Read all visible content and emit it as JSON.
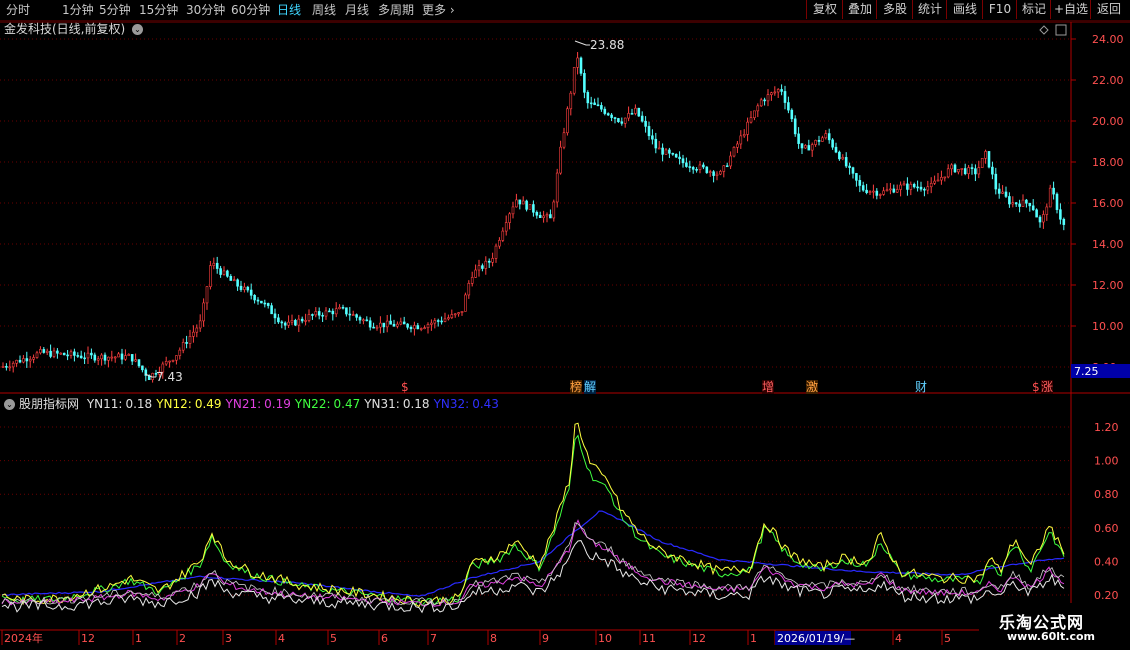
{
  "toolbar": {
    "periods": [
      "分时",
      "1分钟",
      "5分钟",
      "15分钟",
      "30分钟",
      "60分钟",
      "日线",
      "周线",
      "月线",
      "多周期",
      "更多"
    ],
    "active_period": "日线",
    "more_chevron": "chevron-right-icon",
    "buttons": [
      "复权",
      "叠加",
      "多股",
      "统计",
      "画线",
      "F10",
      "标记",
      "+自选",
      "返回"
    ]
  },
  "main_chart": {
    "stock_title": "金发科技(日线,前复权)",
    "high_label": "23.88",
    "low_label": "7.43",
    "current_price_tag": "7.25",
    "price_axis_ticks": [
      "24.00",
      "22.00",
      "20.00",
      "18.00",
      "16.00",
      "14.00",
      "12.00",
      "10.00",
      "8.00"
    ],
    "event_markers": [
      "$",
      "榜",
      "解",
      "增",
      "激",
      "财",
      "$",
      "涨"
    ]
  },
  "indicator": {
    "name": "股朋指标网",
    "items": [
      {
        "label": "YN11:",
        "value": "0.18",
        "color": "#e0e0e0"
      },
      {
        "label": "YN12:",
        "value": "0.49",
        "color": "#ffff40"
      },
      {
        "label": "YN21:",
        "value": "0.19",
        "color": "#e040e0"
      },
      {
        "label": "YN22:",
        "value": "0.47",
        "color": "#40ff40"
      },
      {
        "label": "YN31:",
        "value": "0.18",
        "color": "#e0e0e0"
      },
      {
        "label": "YN32:",
        "value": "0.43",
        "color": "#3030ff"
      }
    ],
    "axis_ticks": [
      "1.20",
      "1.00",
      "0.80",
      "0.60",
      "0.40",
      "0.20"
    ]
  },
  "date_axis": {
    "labels": [
      "2024年",
      "12",
      "1",
      "2",
      "3",
      "4",
      "5",
      "6",
      "7",
      "8",
      "9",
      "10",
      "11",
      "12",
      "1",
      "2026/01/19/—",
      "4",
      "5"
    ],
    "highlight": "2026/01/19/—"
  },
  "watermark": {
    "title": "乐淘公式网",
    "url": "www.60lt.com"
  },
  "colors": {
    "up": "#ff4040",
    "down": "#54ffff",
    "grid": "#7a0000",
    "axis_text": "#ff5050"
  }
}
